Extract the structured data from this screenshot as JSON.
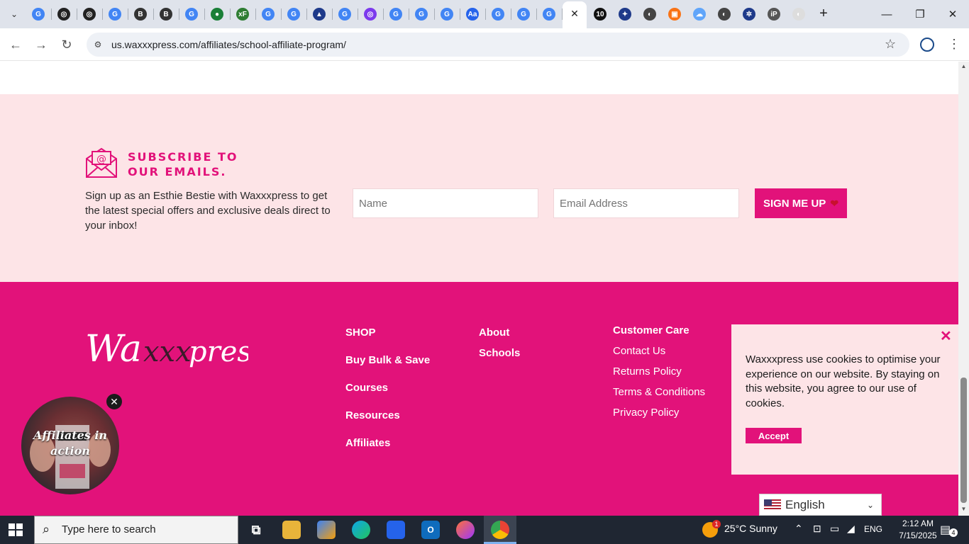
{
  "browser": {
    "url": "us.waxxxpress.com/affiliates/school-affiliate-program/",
    "tab_favicons": [
      "G",
      "◎",
      "◎",
      "G",
      "B",
      "B",
      "G",
      "●",
      "xF",
      "G",
      "G",
      "▲",
      "G",
      "◎",
      "G",
      "G",
      "G",
      "Aa",
      "G",
      "G",
      "G"
    ],
    "extra_tabs": [
      "10",
      "✦",
      "◐",
      "▣",
      "☁",
      "◐",
      "✲",
      "iP",
      "◐"
    ],
    "active_close": "✕",
    "new_tab": "+",
    "minimize": "—",
    "maximize": "❐",
    "close": "✕"
  },
  "subscribe": {
    "title": "SUBSCRIBE TO OUR EMAILS.",
    "text": "Sign up as an Esthie Bestie with Waxxxpress to get the latest special offers and exclusive deals direct to your inbox!",
    "name_placeholder": "Name",
    "email_placeholder": "Email Address",
    "button_label": "SIGN ME UP",
    "button_icon": "❤"
  },
  "footer": {
    "logo_text": "Waxxxpress",
    "col1": [
      "SHOP",
      "Buy Bulk & Save",
      "Courses",
      "Resources",
      "Affiliates"
    ],
    "col2": [
      "About",
      "Schools"
    ],
    "col3_title": "Customer Care",
    "col3": [
      "Contact Us",
      "Returns Policy",
      "Terms & Conditions",
      "Privacy Policy"
    ]
  },
  "affiliate_popup": {
    "text": "Affiliates in action",
    "close": "✕"
  },
  "cookie": {
    "text": "Waxxxpress use cookies to optimise your experience on our website. By staying on this website, you agree to our use of cookies.",
    "accept_label": "Accept",
    "close": "✕"
  },
  "language": {
    "selected": "English"
  },
  "taskbar": {
    "search_placeholder": "Type here to search",
    "weather_badge": "1",
    "weather": "25°C  Sunny",
    "language": "ENG",
    "time": "2:12 AM",
    "date": "7/15/2025",
    "notifications": "4"
  },
  "colors": {
    "brand_pink": "#e2127a",
    "light_pink": "#fde4e7"
  }
}
